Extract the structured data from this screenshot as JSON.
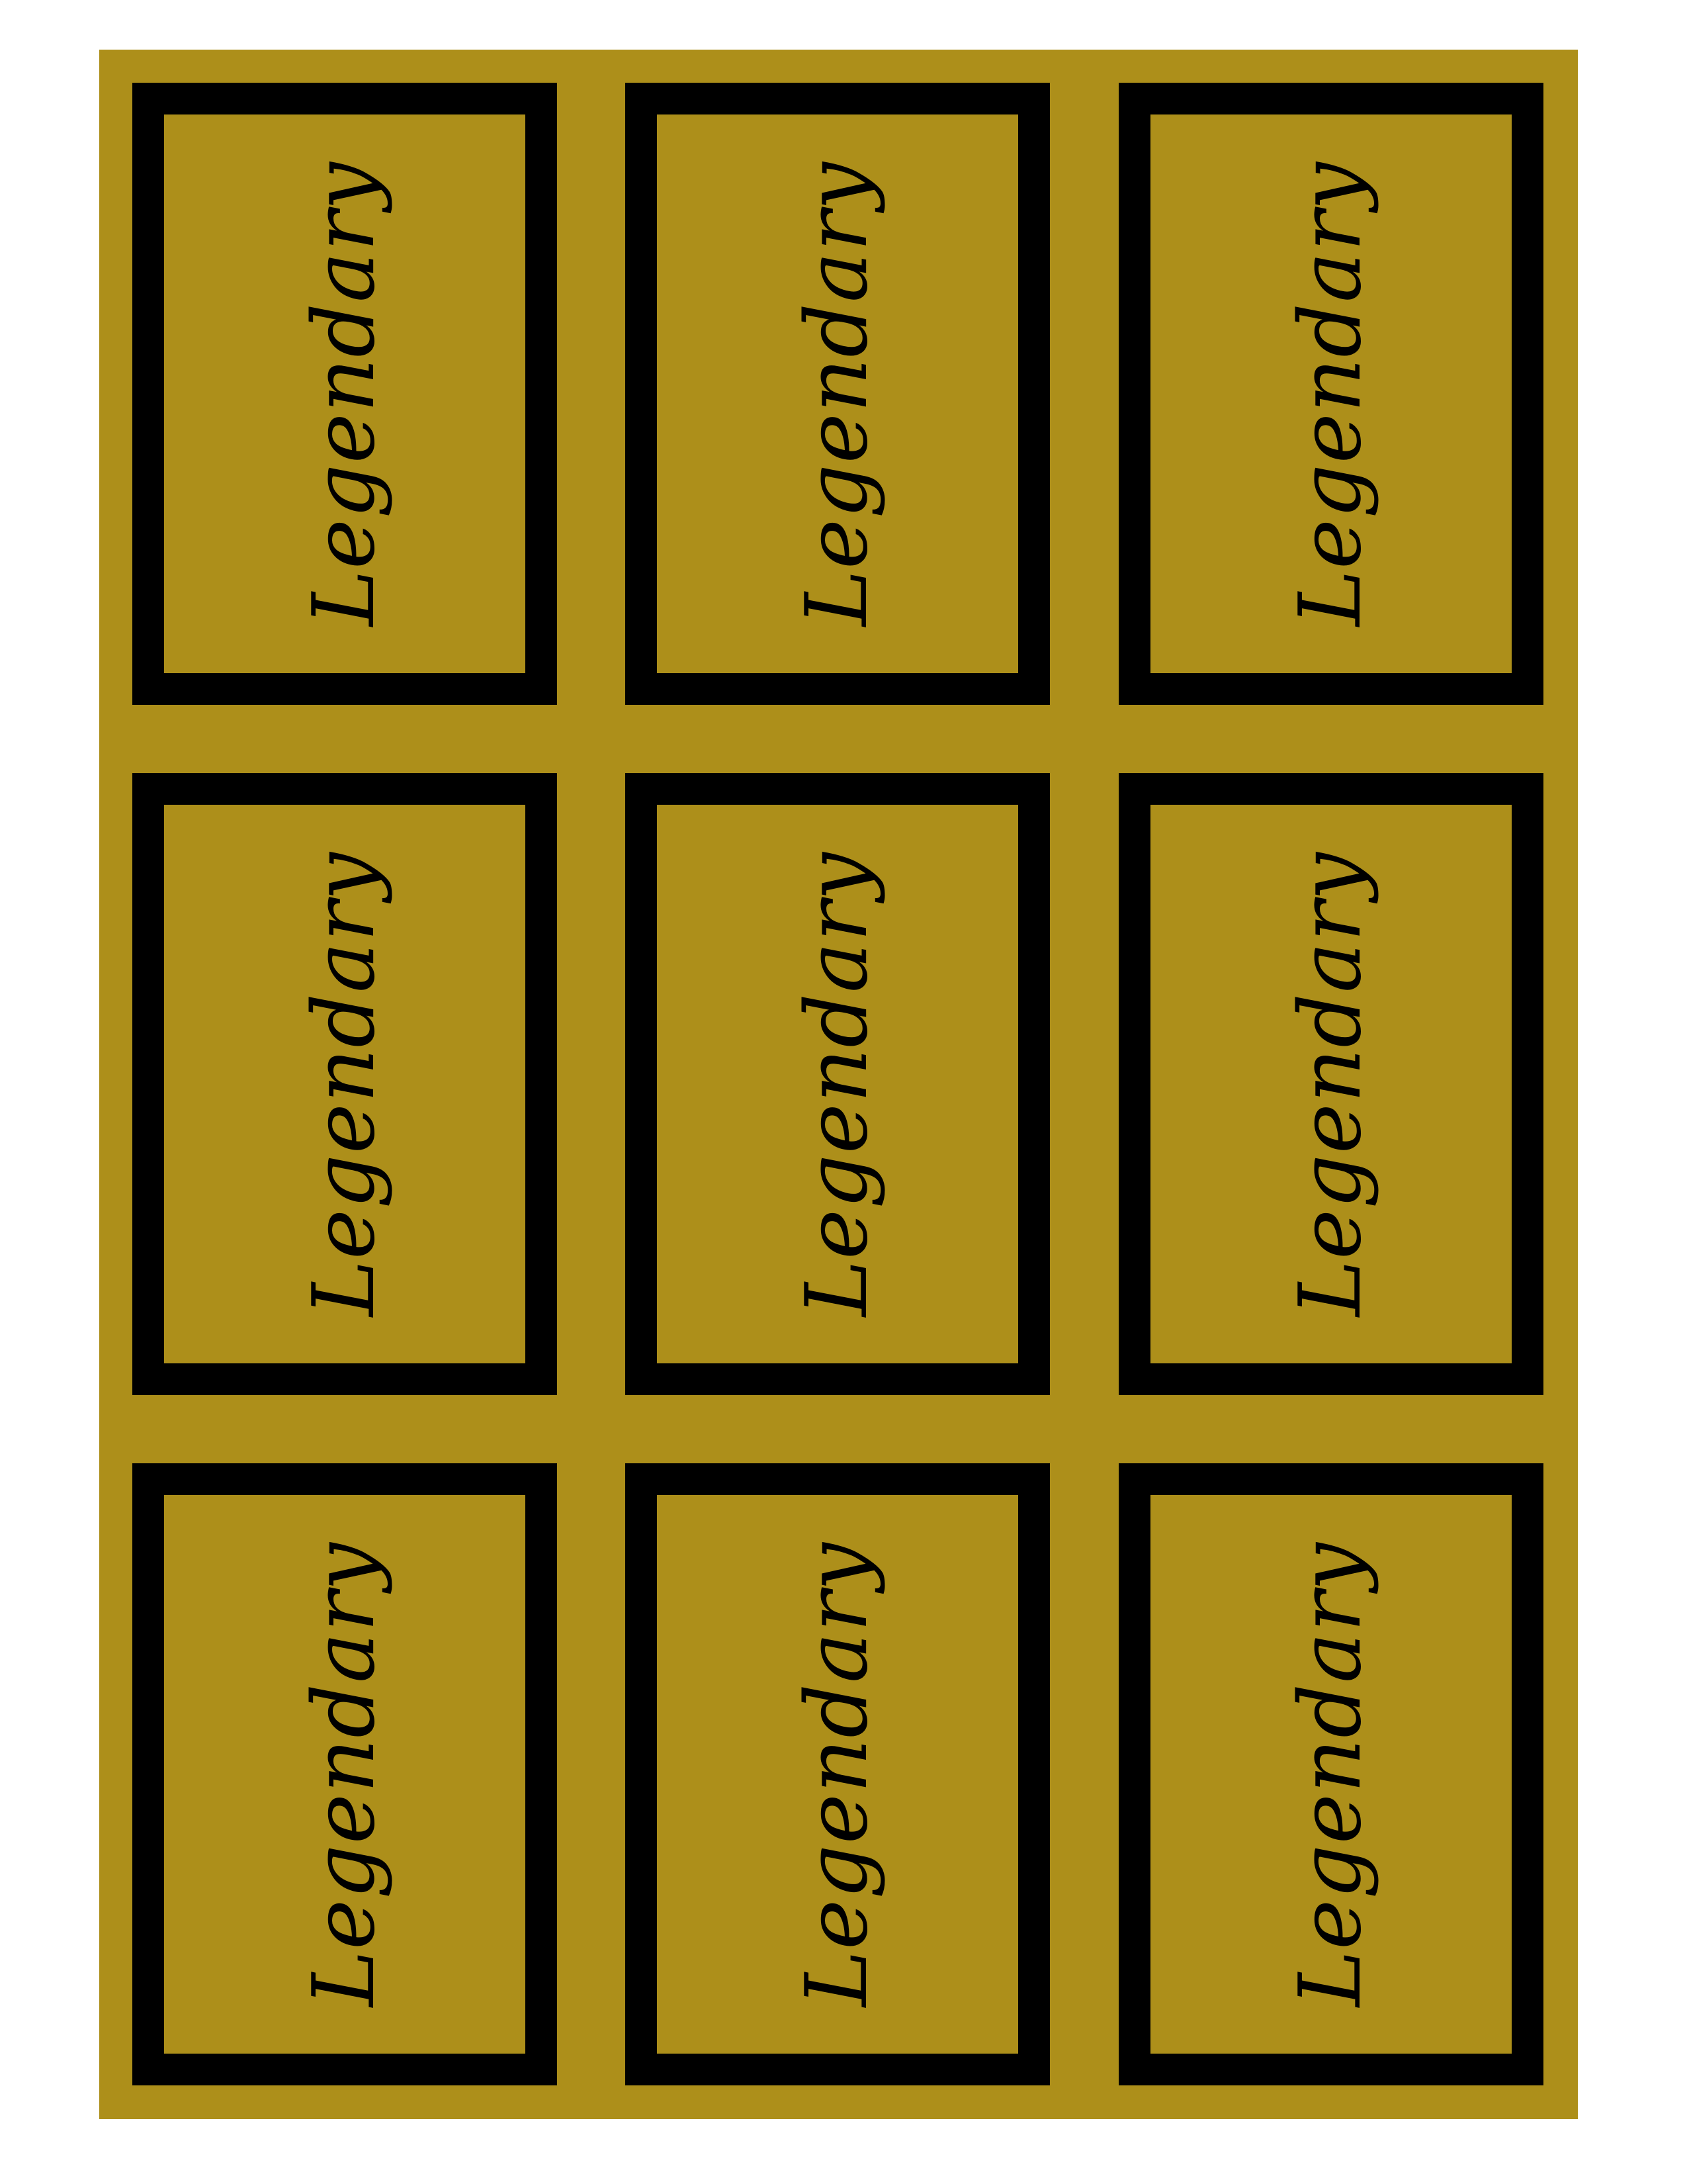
{
  "colors": {
    "sheet_background": "#ad8f1a",
    "card_border": "#000000",
    "label_text": "#000000"
  },
  "cards": [
    {
      "label": "Legendary"
    },
    {
      "label": "Legendary"
    },
    {
      "label": "Legendary"
    },
    {
      "label": "Legendary"
    },
    {
      "label": "Legendary"
    },
    {
      "label": "Legendary"
    },
    {
      "label": "Legendary"
    },
    {
      "label": "Legendary"
    },
    {
      "label": "Legendary"
    }
  ]
}
